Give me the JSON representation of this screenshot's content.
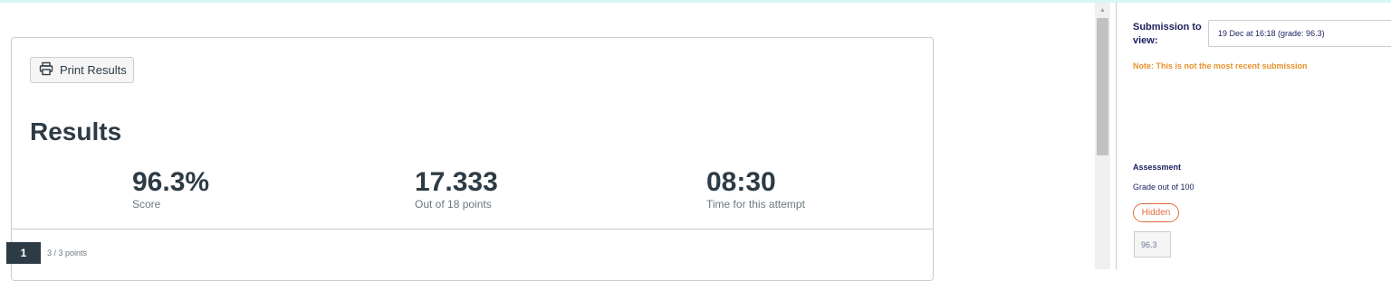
{
  "results": {
    "print_label": "Print Results",
    "title": "Results",
    "stats": [
      {
        "value": "96.3%",
        "label": "Score"
      },
      {
        "value": "17.333",
        "label": "Out of 18 points"
      },
      {
        "value": "08:30",
        "label": "Time for this attempt"
      }
    ]
  },
  "question": {
    "number": "1",
    "points": "3 / 3 points"
  },
  "grading": {
    "submission_label": "Submission to view:",
    "submission_value": "19 Dec at 16:18 (grade: 96.3)",
    "note": "Note: This is not the most recent submission",
    "assessment_title": "Assessment",
    "grade_out_of": "Grade out of 100",
    "hidden_label": "Hidden",
    "grade_value": "96.3"
  },
  "colors": {
    "heading": "#2d3b45",
    "panel_text": "#1b1f5e",
    "note": "#e8912a",
    "hidden": "#e16a3e"
  },
  "icons": {
    "print": "printer-icon",
    "scroll_up": "scroll-up-arrow-icon"
  }
}
